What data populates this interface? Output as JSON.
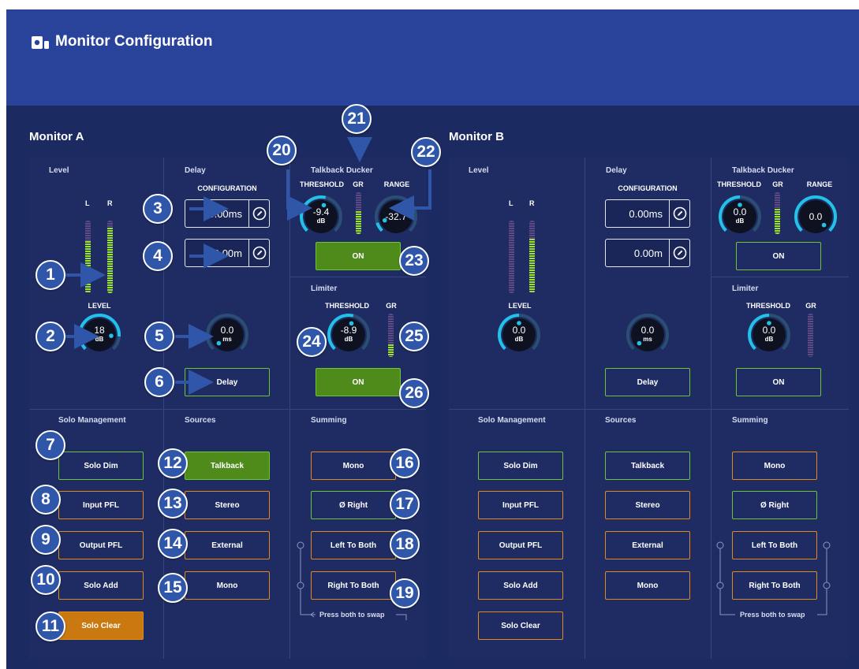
{
  "app": {
    "title": "Monitor Configuration",
    "icon": "monitor-speaker-icon"
  },
  "monitor_a": {
    "title": "Monitor A",
    "level": {
      "section": "Level",
      "meter_l": "L",
      "meter_r": "R",
      "knob_label": "LEVEL",
      "knob_value": "18",
      "knob_unit": "dB",
      "meter_l_fill": 0.72,
      "meter_r_fill": 0.9
    },
    "delay": {
      "section": "Delay",
      "config_label": "CONFIGURATION",
      "time_value": "0.00ms",
      "distance_value": "0.00m",
      "knob_value": "0.0",
      "knob_unit": "ms",
      "button": "Delay"
    },
    "ducker": {
      "section": "Talkback Ducker",
      "threshold_label": "THRESHOLD",
      "gr_label": "GR",
      "range_label": "RANGE",
      "threshold_value": "-9.4",
      "threshold_unit": "dB",
      "range_value": "-32.7",
      "button": "ON",
      "gr_fill": 0.55
    },
    "limiter": {
      "section": "Limiter",
      "threshold_label": "THRESHOLD",
      "gr_label": "GR",
      "threshold_value": "-8.9",
      "threshold_unit": "dB",
      "button": "ON",
      "gr_fill": 0.3
    },
    "solo": {
      "section": "Solo Management",
      "items": [
        "Solo Dim",
        "Input PFL",
        "Output PFL",
        "Solo Add",
        "Solo Clear"
      ]
    },
    "sources": {
      "section": "Sources",
      "items": [
        "Talkback",
        "Stereo",
        "External",
        "Mono"
      ]
    },
    "summing": {
      "section": "Summing",
      "items": [
        "Mono",
        "Ø Right",
        "Left To Both",
        "Right To Both"
      ],
      "swap_hint": "Press both to swap"
    }
  },
  "monitor_b": {
    "title": "Monitor B",
    "level": {
      "section": "Level",
      "meter_l": "L",
      "meter_r": "R",
      "knob_label": "LEVEL",
      "knob_value": "0.0",
      "knob_unit": "dB",
      "meter_l_fill": 0.0,
      "meter_r_fill": 0.75
    },
    "delay": {
      "section": "Delay",
      "config_label": "CONFIGURATION",
      "time_value": "0.00ms",
      "distance_value": "0.00m",
      "knob_value": "0.0",
      "knob_unit": "ms",
      "button": "Delay"
    },
    "ducker": {
      "section": "Talkback Ducker",
      "threshold_label": "THRESHOLD",
      "gr_label": "GR",
      "range_label": "RANGE",
      "threshold_value": "0.0",
      "threshold_unit": "dB",
      "range_value": "0.0",
      "button": "ON",
      "gr_fill": 0.6
    },
    "limiter": {
      "section": "Limiter",
      "threshold_label": "THRESHOLD",
      "gr_label": "GR",
      "threshold_value": "0.0",
      "threshold_unit": "dB",
      "button": "ON",
      "gr_fill": 0.0
    },
    "solo": {
      "section": "Solo Management",
      "items": [
        "Solo Dim",
        "Input PFL",
        "Output PFL",
        "Solo Add",
        "Solo Clear"
      ]
    },
    "sources": {
      "section": "Sources",
      "items": [
        "Talkback",
        "Stereo",
        "External",
        "Mono"
      ]
    },
    "summing": {
      "section": "Summing",
      "items": [
        "Mono",
        "Ø Right",
        "Left To Both",
        "Right To Both"
      ],
      "swap_hint": "Press both to swap"
    }
  },
  "callouts": [
    "1",
    "2",
    "3",
    "4",
    "5",
    "6",
    "7",
    "8",
    "9",
    "10",
    "11",
    "12",
    "13",
    "14",
    "15",
    "16",
    "17",
    "18",
    "19",
    "20",
    "21",
    "22",
    "23",
    "24",
    "25",
    "26"
  ],
  "colors": {
    "background": "#1b2a60",
    "header": "#2a439a",
    "green": "#6ec531",
    "orange": "#e08a1c",
    "callout": "#2f56a8",
    "knob_ring": "#23c1e8"
  }
}
